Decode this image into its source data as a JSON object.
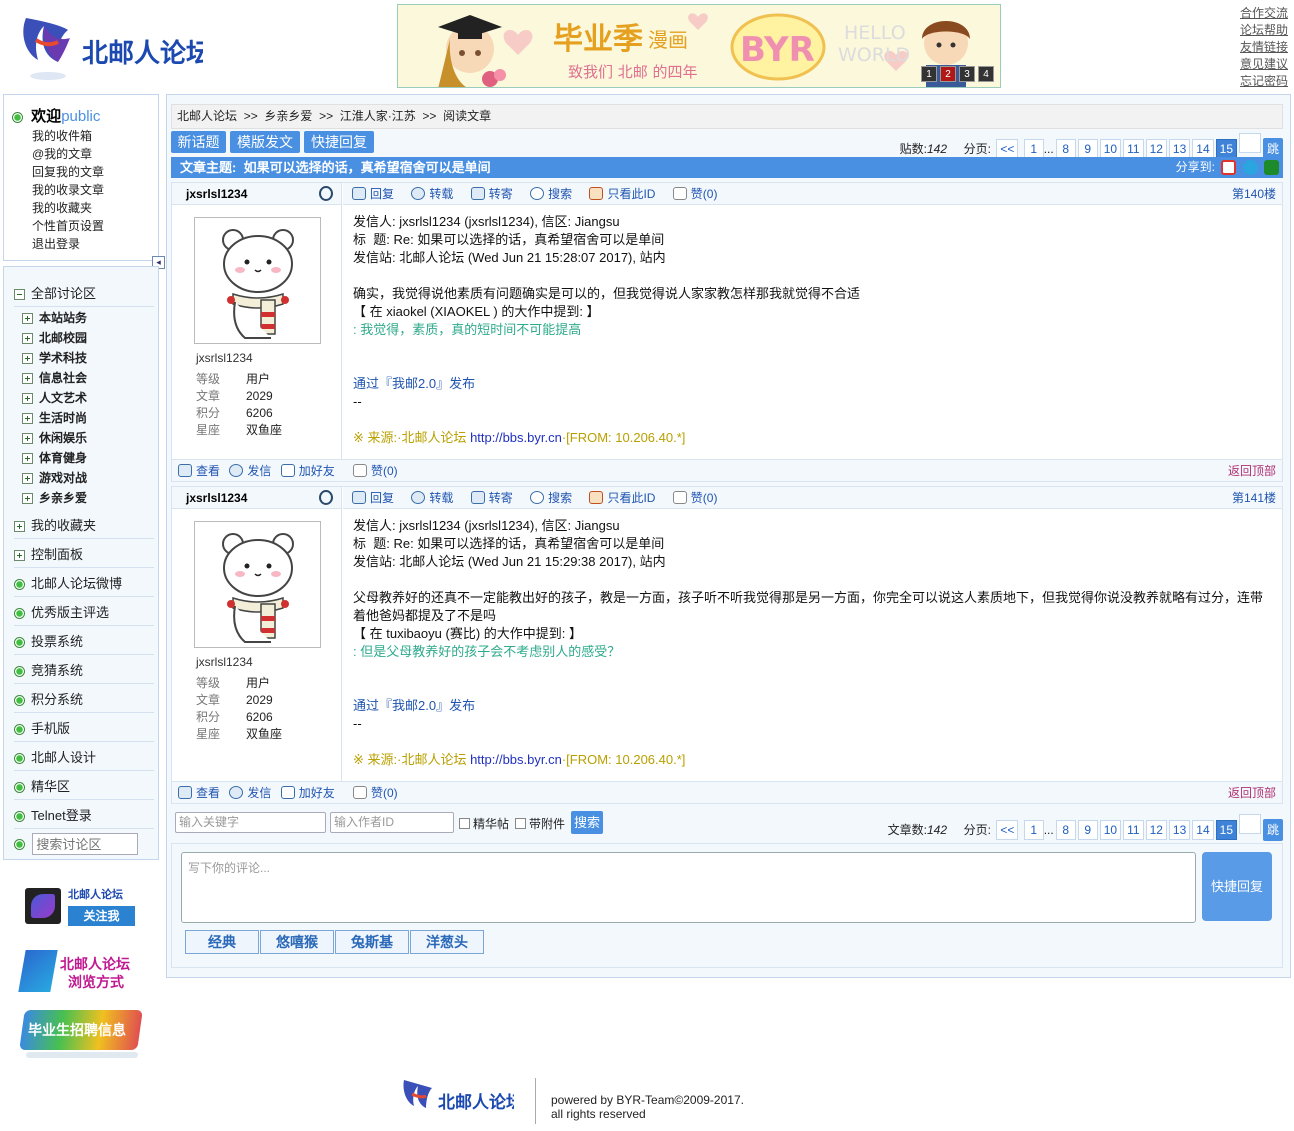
{
  "site": {
    "logo_text": "北邮人论坛"
  },
  "banner": {
    "title": "毕业季",
    "title2": "漫画",
    "subtitle": "致我们 北邮 的四年",
    "byr": "BYR",
    "hello": "HELLO",
    "world": "WORLD",
    "slides": [
      "1",
      "2",
      "3",
      "4"
    ],
    "active_slide": 2
  },
  "toplinks": [
    "合作交流",
    "论坛帮助",
    "友情链接",
    "意见建议",
    "忘记密码"
  ],
  "user_panel": {
    "welcome": "欢迎",
    "username": "public",
    "items": [
      "我的收件箱",
      "@我的文章",
      "回复我的文章",
      "我的收录文章",
      "我的收藏夹",
      "个性首页设置",
      "退出登录"
    ]
  },
  "nav": {
    "all_boards": "全部讨论区",
    "sections": [
      "本站站务",
      "北邮校园",
      "学术科技",
      "信息社会",
      "人文艺术",
      "生活时尚",
      "休闲娱乐",
      "体育健身",
      "游戏对战",
      "乡亲乡爱"
    ],
    "favorites": "我的收藏夹",
    "control_panel": "控制面板",
    "links": [
      "北邮人论坛微博",
      "优秀版主评选",
      "投票系统",
      "竞猜系统",
      "积分系统",
      "手机版",
      "北邮人设计",
      "精华区",
      "Telnet登录"
    ],
    "search_placeholder": "搜索讨论区"
  },
  "promos": {
    "weibo_title": "北邮人论坛",
    "weibo_btn": "关注我",
    "browse_1": "北邮人论坛",
    "browse_2": "浏览方式",
    "jobs": "毕业生招聘信息"
  },
  "breadcrumb": [
    "北邮人论坛",
    ">>",
    "乡亲乡爱",
    ">>",
    "江淮人家·江苏",
    ">>",
    "阅读文章"
  ],
  "toolbar": {
    "new_topic": "新话题",
    "template_post": "模版发文",
    "quick_reply": "快捷回复"
  },
  "pager_top": {
    "count_label": "贴数:",
    "count": "142",
    "pages_label": "分页:",
    "prev": "<<",
    "pages": [
      "1",
      "...",
      "8",
      "9",
      "10",
      "11",
      "12",
      "13",
      "14",
      "15"
    ],
    "current": "15",
    "jump": "跳"
  },
  "topic": {
    "label": "文章主题:",
    "title": "如果可以选择的话，真希望宿舍可以是单间",
    "share_label": "分享到:"
  },
  "post_actions": [
    "回复",
    "转载",
    "转寄",
    "搜索",
    "只看此ID",
    "赞(0)"
  ],
  "user_actions": [
    "查看",
    "发信",
    "加好友"
  ],
  "stat_labels": [
    "等级",
    "文章",
    "积分",
    "星座"
  ],
  "posts": [
    {
      "author": "jxsrlsl1234",
      "stats": [
        "用户",
        "2029",
        "6206",
        "双鱼座"
      ],
      "floor": "第140楼",
      "lines": [
        "发信人: jxsrlsl1234 (jxsrlsl1234), 信区: Jiangsu",
        "标  题: Re: 如果可以选择的话，真希望宿舍可以是单间",
        "发信站: 北邮人论坛 (Wed Jun 21 15:28:07 2017), 站内",
        "",
        "确实，我觉得说他素质有问题确实是可以的，但我觉得说人家家教怎样那我就觉得不合适",
        "【 在 xiaokel (XIAOKEL ) 的大作中提到: 】"
      ],
      "quote": ": 我觉得，素质，真的短时间不可能提高",
      "publish": "通过『我邮2.0』发布",
      "sig": "--",
      "source_prefix": "※ 来源:·北邮人论坛 ",
      "source_link": "http://bbs.byr.cn",
      "source_from": "·[FROM: 10.206.40.*]",
      "like": "赞(0)",
      "back_top": "返回顶部"
    },
    {
      "author": "jxsrlsl1234",
      "stats": [
        "用户",
        "2029",
        "6206",
        "双鱼座"
      ],
      "floor": "第141楼",
      "lines": [
        "发信人: jxsrlsl1234 (jxsrlsl1234), 信区: Jiangsu",
        "标  题: Re: 如果可以选择的话，真希望宿舍可以是单间",
        "发信站: 北邮人论坛 (Wed Jun 21 15:29:38 2017), 站内",
        "",
        "父母教养好的还真不一定能教出好的孩子，教是一方面，孩子听不听我觉得那是另一方面，你完全可以说这人素质地下，但我觉得你说没教养就略有过分，连带着他爸妈都提及了不是吗",
        "【 在 tuxibaoyu (赛比) 的大作中提到: 】"
      ],
      "quote": ": 但是父母教养好的孩子会不考虑别人的感受？",
      "publish": "通过『我邮2.0』发布",
      "sig": "--",
      "source_prefix": "※ 来源:·北邮人论坛 ",
      "source_link": "http://bbs.byr.cn",
      "source_from": "·[FROM: 10.206.40.*]",
      "like": "赞(0)",
      "back_top": "返回顶部"
    }
  ],
  "search_row": {
    "keyword_placeholder": "输入关键字",
    "author_placeholder": "输入作者ID",
    "digest": "精华帖",
    "attachment": "带附件",
    "search_btn": "搜索"
  },
  "pager_bottom": {
    "count_label": "文章数:",
    "count": "142",
    "pages_label": "分页:",
    "prev": "<<",
    "pages": [
      "1",
      "...",
      "8",
      "9",
      "10",
      "11",
      "12",
      "13",
      "14",
      "15"
    ],
    "current": "15",
    "jump": "跳"
  },
  "reply": {
    "placeholder": "写下你的评论...",
    "submit": "快捷回复",
    "emoji_tabs": [
      "经典",
      "悠嘻猴",
      "兔斯基",
      "洋葱头"
    ]
  },
  "footer": {
    "powered": "powered by BYR-Team©2009-2017.",
    "rights": "all rights reserved"
  },
  "colors": {
    "accent": "#4a90e2",
    "panel_bg": "#f3f8fd",
    "border": "#c3d6ec",
    "quote": "#2eaa8c",
    "source": "#b9a000"
  }
}
